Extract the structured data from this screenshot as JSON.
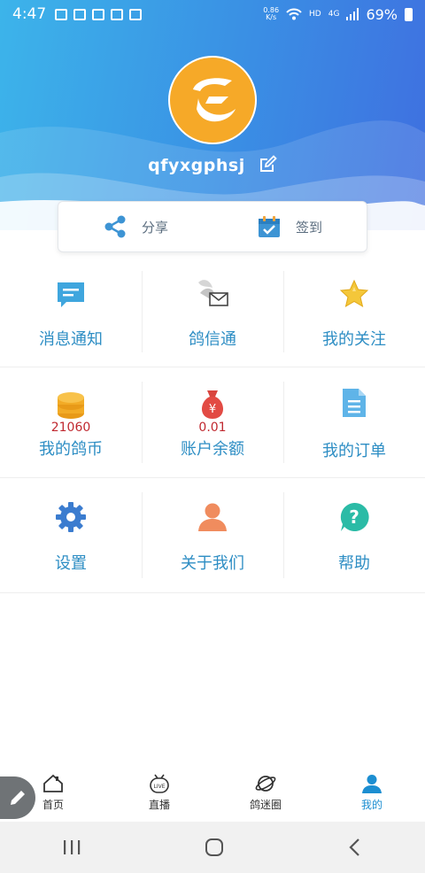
{
  "status_bar": {
    "time": "4:47",
    "net_speed_value": "0.86",
    "net_speed_unit": "K/s",
    "hd_label": "HD",
    "net_type": "4G",
    "battery": "69%"
  },
  "profile": {
    "username": "qfyxgphsj"
  },
  "actions": [
    {
      "label": "分享",
      "icon": "share-icon"
    },
    {
      "label": "签到",
      "icon": "checkin-calendar-icon"
    }
  ],
  "grid": [
    {
      "label": "消息通知",
      "icon": "message-icon"
    },
    {
      "label": "鸽信通",
      "icon": "pigeon-mail-icon"
    },
    {
      "label": "我的关注",
      "icon": "star-icon"
    },
    {
      "label": "我的鸽币",
      "icon": "coins-icon",
      "value": "21060"
    },
    {
      "label": "账户余额",
      "icon": "money-bag-icon",
      "value": "0.01"
    },
    {
      "label": "我的订单",
      "icon": "document-icon"
    },
    {
      "label": "设置",
      "icon": "gear-icon"
    },
    {
      "label": "关于我们",
      "icon": "person-icon"
    },
    {
      "label": "帮助",
      "icon": "help-icon"
    }
  ],
  "tabs": [
    {
      "label": "首页",
      "icon": "home-icon",
      "active": false
    },
    {
      "label": "直播",
      "icon": "live-icon",
      "active": false
    },
    {
      "label": "鸽迷圈",
      "icon": "planet-icon",
      "active": false
    },
    {
      "label": "我的",
      "icon": "user-icon",
      "active": true
    }
  ],
  "colors": {
    "header_start": "#3cb4ea",
    "header_end": "#3f6fe0",
    "accent": "#1c8ed1",
    "label_blue": "#2e8ec4",
    "value_red": "#c0282f",
    "avatar_orange": "#f6a928"
  }
}
